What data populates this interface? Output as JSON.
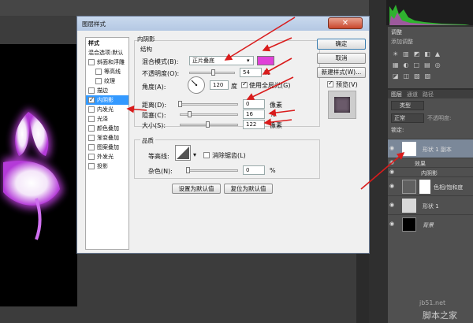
{
  "dialog": {
    "title": "图层样式",
    "close_symbol": "✕"
  },
  "style_list": {
    "header": "样式",
    "blend_default": "混合选项:默认",
    "items": [
      {
        "label": "斜面和浮雕",
        "checked": false
      },
      {
        "label": "等高线",
        "checked": false,
        "indent": true
      },
      {
        "label": "纹理",
        "checked": false,
        "indent": true
      },
      {
        "label": "描边",
        "checked": false
      },
      {
        "label": "内阴影",
        "checked": true,
        "selected": true
      },
      {
        "label": "内发光",
        "checked": false
      },
      {
        "label": "光泽",
        "checked": false
      },
      {
        "label": "颜色叠加",
        "checked": false
      },
      {
        "label": "渐变叠加",
        "checked": false
      },
      {
        "label": "图案叠加",
        "checked": false
      },
      {
        "label": "外发光",
        "checked": false
      },
      {
        "label": "投影",
        "checked": false
      }
    ]
  },
  "inner_shadow": {
    "section_title": "内阴影",
    "structure_title": "结构",
    "blend_mode_label": "混合模式(B):",
    "blend_mode_value": "正片叠底",
    "shadow_color": "#e040d8",
    "opacity_label": "不透明度(O):",
    "opacity_value": "54",
    "opacity_fraction": 0.54,
    "angle_label": "角度(A):",
    "angle_value": "120",
    "angle_unit": "度",
    "global_light_label": "使用全局光(G)",
    "global_light_checked": true,
    "distance_label": "距离(D):",
    "distance_value": "0",
    "distance_fraction": 0.0,
    "choke_label": "阻塞(C):",
    "choke_value": "16",
    "choke_fraction": 0.16,
    "size_label": "大小(S):",
    "size_value": "122",
    "size_fraction": 0.49,
    "px_unit": "像素",
    "percent_unit": "%",
    "quality_title": "品质",
    "contour_label": "等高线:",
    "antialias_label": "消除锯齿(L)",
    "noise_label": "杂色(N):",
    "noise_value": "0",
    "noise_fraction": 0.0,
    "set_default_btn": "设置为默认值",
    "reset_default_btn": "复位为默认值"
  },
  "actions": {
    "ok": "确定",
    "cancel": "取消",
    "new_style": "新建样式(W)...",
    "preview_label": "预览(V)",
    "preview_checked": true
  },
  "ps": {
    "adjust_tab": "调整",
    "adjust_hint": "添加调整",
    "layers_tabs": [
      "图层",
      "通道",
      "路径"
    ],
    "kind_filter": "类型",
    "blend_mode": "正常",
    "opacity_label": "不透明度:",
    "lock_label": "锁定:",
    "layers": [
      {
        "name": "形状 1 副本",
        "selected": true
      },
      {
        "name": "效果",
        "sub": true
      },
      {
        "name": "内阴影",
        "sub2": true
      },
      {
        "name": "色相/饱和度"
      },
      {
        "name": "形状 1"
      },
      {
        "name": "背景"
      }
    ],
    "watermark_1": "jb51.net",
    "watermark_2": "脚本之家"
  },
  "colors": {
    "glow": "#c040e0",
    "selected_blue": "#3399ff",
    "arrow_red": "#d91c1c"
  }
}
